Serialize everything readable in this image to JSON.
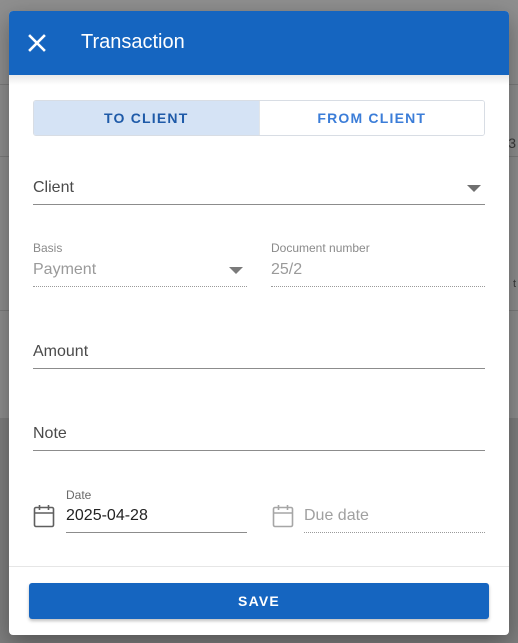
{
  "dialog": {
    "title": "Transaction",
    "close_icon": "close-icon"
  },
  "direction_toggle": {
    "options": [
      "TO CLIENT",
      "FROM CLIENT"
    ],
    "selected": "TO CLIENT"
  },
  "form": {
    "client": {
      "placeholder": "Client",
      "value": ""
    },
    "basis": {
      "label": "Basis",
      "value": "Payment"
    },
    "document_number": {
      "label": "Document number",
      "value": "25/2"
    },
    "amount": {
      "placeholder": "Amount",
      "value": ""
    },
    "note": {
      "placeholder": "Note",
      "value": ""
    },
    "date": {
      "label": "Date",
      "value": "2025-04-28",
      "icon": "calendar-icon"
    },
    "due_date": {
      "placeholder": "Due date",
      "value": "",
      "icon": "calendar-icon"
    }
  },
  "footer": {
    "save_label": "SAVE"
  },
  "background": {
    "edge_texts": [
      "3",
      "t"
    ]
  },
  "colors": {
    "primary": "#1565c0",
    "toggle_active_bg": "#d5e3f5",
    "toggle_active_text": "#1e5aa8",
    "toggle_inactive_text": "#3b7dd8"
  }
}
